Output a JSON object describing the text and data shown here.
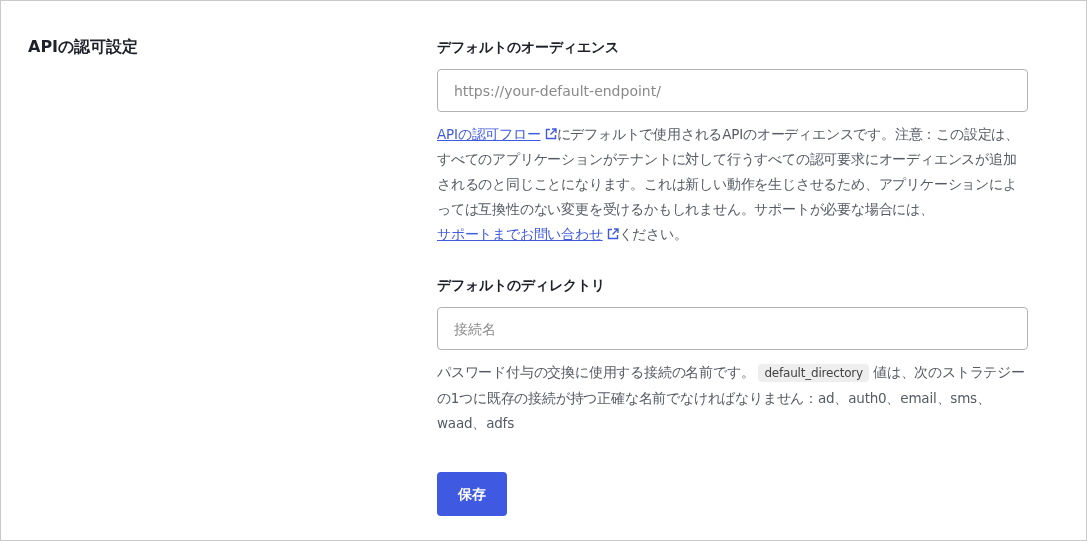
{
  "section": {
    "title": "APIの認可設定"
  },
  "fields": [
    {
      "label": "デフォルトのオーディエンス",
      "placeholder": "https://your-default-endpoint/",
      "help": [
        {
          "kind": "link",
          "text": "APIの認可フロー"
        },
        {
          "kind": "text",
          "text": "にデフォルトで使用されるAPIのオーディエンスです。注意：この設定は、すべてのアプリケーションがテナントに対して行うすべての認可要求にオーディエンスが追加されるのと同じことになります。これは新しい動作を生じさせるため、アプリケーションによっては互換性のない変更を受けるかもしれません。サポートが必要な場合には、"
        },
        {
          "kind": "link",
          "text": "サポートまでお問い合わせ"
        },
        {
          "kind": "text",
          "text": "ください。"
        }
      ]
    },
    {
      "label": "デフォルトのディレクトリ",
      "placeholder": "接続名",
      "help": [
        {
          "kind": "text",
          "text": "パスワード付与の交換に使用する接続の名前です。"
        },
        {
          "kind": "code",
          "text": "default_directory"
        },
        {
          "kind": "text",
          "text": "値は、次のストラテジーの1つに既存の接続が持つ正確な名前でなければなりません：ad、auth0、email、sms、waad、adfs"
        }
      ]
    }
  ],
  "save_button": "保存"
}
